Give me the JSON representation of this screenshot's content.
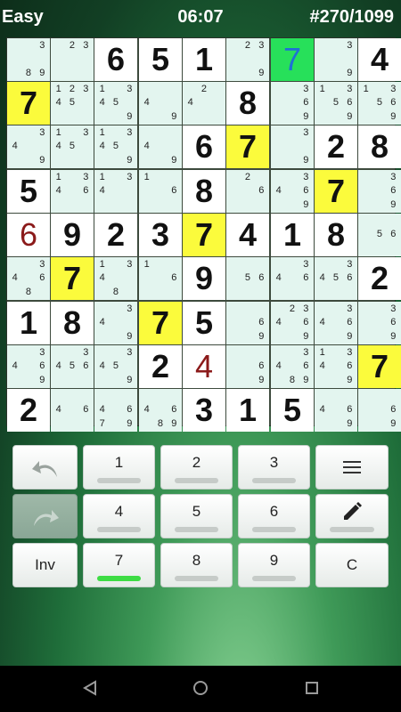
{
  "header": {
    "difficulty": "Easy",
    "timer": "06:07",
    "puzzle": "#270/1099"
  },
  "board": {
    "cells": [
      [
        {
          "c": "3 89"
        },
        {
          "c": "23"
        },
        {
          "v": "6"
        },
        {
          "v": "5"
        },
        {
          "v": "1"
        },
        {
          "c": "23 9"
        },
        {
          "v": "7",
          "style": "blue",
          "bg": "green"
        },
        {
          "c": "3 9"
        },
        {
          "v": "4"
        }
      ],
      [
        {
          "v": "7",
          "bg": "yellow"
        },
        {
          "c": "123 45"
        },
        {
          "c": "13 45 9"
        },
        {
          "c": "4 9"
        },
        {
          "c": "2 4"
        },
        {
          "v": "8"
        },
        {
          "c": "3 6 9"
        },
        {
          "c": "13 56 9"
        },
        {
          "c": "13 56 9"
        }
      ],
      [
        {
          "c": "3 4 9"
        },
        {
          "c": "13 45"
        },
        {
          "c": "13 45 9"
        },
        {
          "c": "4 9"
        },
        {
          "v": "6"
        },
        {
          "v": "7",
          "bg": "yellow"
        },
        {
          "c": "3 9"
        },
        {
          "v": "2"
        },
        {
          "v": "8"
        }
      ],
      [
        {
          "v": "5"
        },
        {
          "c": "136 14"
        },
        {
          "c": "13 14"
        },
        {
          "c": "1 6"
        },
        {
          "v": "8"
        },
        {
          "c": "2 6"
        },
        {
          "c": "3 46 9"
        },
        {
          "v": "7",
          "bg": "yellow"
        },
        {
          "c": "3 6 9"
        }
      ],
      [
        {
          "v": "6",
          "style": "red"
        },
        {
          "v": "9"
        },
        {
          "v": "2"
        },
        {
          "v": "3"
        },
        {
          "v": "7",
          "bg": "yellow"
        },
        {
          "v": "4"
        },
        {
          "v": "1"
        },
        {
          "v": "8"
        },
        {
          "c": "56"
        }
      ],
      [
        {
          "c": "3 46 8"
        },
        {
          "v": "7",
          "bg": "yellow"
        },
        {
          "c": "13 4 8"
        },
        {
          "c": "1 6"
        },
        {
          "v": "9"
        },
        {
          "c": "56"
        },
        {
          "c": "3 46"
        },
        {
          "c": "3 456"
        },
        {
          "v": "2"
        }
      ],
      [
        {
          "v": "1"
        },
        {
          "v": "8"
        },
        {
          "c": "3 4 9"
        },
        {
          "v": "7",
          "bg": "yellow"
        },
        {
          "v": "5"
        },
        {
          "c": "6 9"
        },
        {
          "c": "23 46 9"
        },
        {
          "c": "3 46 9"
        },
        {
          "c": "3 6 9"
        }
      ],
      [
        {
          "c": "3 46 9"
        },
        {
          "c": "3 456"
        },
        {
          "c": "3 45 9"
        },
        {
          "v": "2"
        },
        {
          "v": "4",
          "style": "red"
        },
        {
          "c": "6 9"
        },
        {
          "c": "3 46 89"
        },
        {
          "c": "13 46 9"
        },
        {
          "v": "7",
          "bg": "yellow"
        }
      ],
      [
        {
          "v": "2"
        },
        {
          "c": "46"
        },
        {
          "c": "46 47 9"
        },
        {
          "c": "46 8 9"
        },
        {
          "v": "3"
        },
        {
          "v": "1"
        },
        {
          "v": "5"
        },
        {
          "c": "46 9"
        },
        {
          "c": "6 9"
        }
      ]
    ]
  },
  "keypad": {
    "undo_label": "Undo",
    "redo_label": "Redo",
    "inv_label": "Inv",
    "clear_label": "C",
    "menu_label": "Menu",
    "pencil_label": "Pencil",
    "digits": [
      "1",
      "2",
      "3",
      "4",
      "5",
      "6",
      "7",
      "8",
      "9"
    ],
    "active_digit": "7"
  },
  "nav": {
    "back": "back-icon",
    "home": "home-icon",
    "recent": "recent-apps-icon"
  },
  "colors": {
    "highlight": "#fbfb3c",
    "selected": "#27e05a",
    "active_bar": "#3ddc44"
  }
}
